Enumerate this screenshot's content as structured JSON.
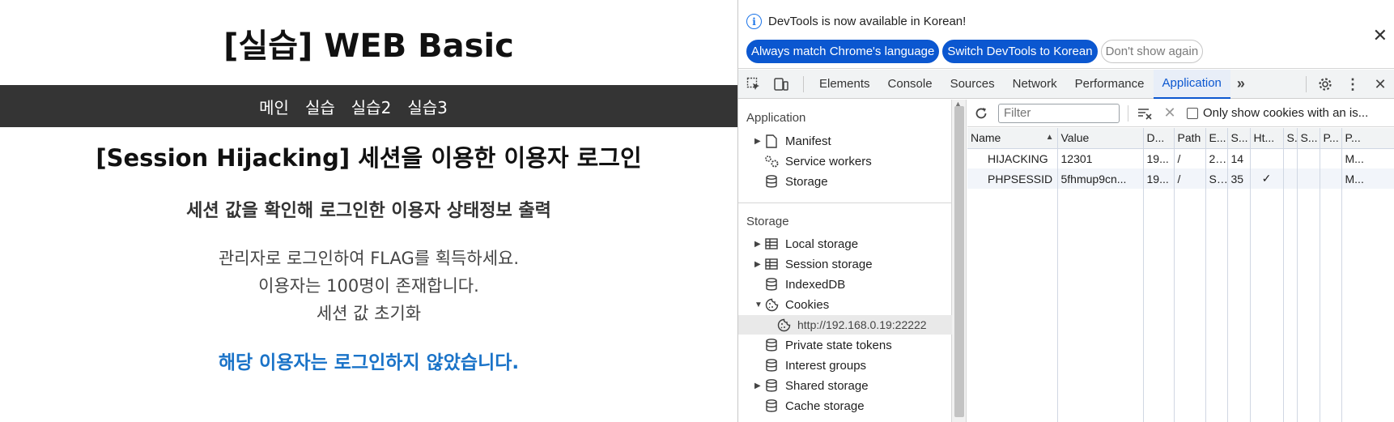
{
  "page": {
    "site_title": "[실습] WEB Basic",
    "nav": [
      "메인",
      "실습",
      "실습2",
      "실습3"
    ],
    "heading": "[Session Hijacking] 세션을 이용한 이용자 로그인",
    "subheading": "세션 값을 확인해 로그인한 이용자 상태정보 출력",
    "desc1": "관리자로 로그인하여 FLAG를 획득하세요.",
    "desc2": "이용자는 100명이 존재합니다.",
    "desc3": "세션 값 초기화",
    "status": "해당 이용자는 로그인하지 않았습니다."
  },
  "devtools": {
    "infobar": {
      "message": "DevTools is now available in Korean!",
      "btn_match": "Always match Chrome's language",
      "btn_switch": "Switch DevTools to Korean",
      "btn_dismiss": "Don't show again"
    },
    "tabs": [
      "Elements",
      "Console",
      "Sources",
      "Network",
      "Performance",
      "Application"
    ],
    "active_tab": "Application",
    "sidebar": {
      "application_label": "Application",
      "manifest": "Manifest",
      "service_workers": "Service workers",
      "storage_item": "Storage",
      "storage_label": "Storage",
      "local_storage": "Local storage",
      "session_storage": "Session storage",
      "indexeddb": "IndexedDB",
      "cookies": "Cookies",
      "cookie_origin": "http://192.168.0.19:22222",
      "private_state_tokens": "Private state tokens",
      "interest_groups": "Interest groups",
      "shared_storage": "Shared storage",
      "cache_storage": "Cache storage"
    },
    "filter": {
      "placeholder": "Filter",
      "only_show_label": "Only show cookies with an is..."
    },
    "table": {
      "headers": [
        "Name",
        "Value",
        "D...",
        "Path",
        "E...",
        "S...",
        "Ht...",
        "S.",
        "S...",
        "P...",
        "P..."
      ],
      "rows": [
        [
          "HIJACKING",
          "12301",
          "19...",
          "/",
          "2...",
          "14",
          "",
          "",
          "",
          "",
          "M..."
        ],
        [
          "PHPSESSID",
          "5fhmup9cn...",
          "19...",
          "/",
          "S...",
          "35",
          "✓",
          "",
          "",
          "",
          "M..."
        ]
      ]
    },
    "colors": {
      "accent": "#0b57d0",
      "link": "#1a73c8",
      "navbar": "#343434"
    }
  }
}
